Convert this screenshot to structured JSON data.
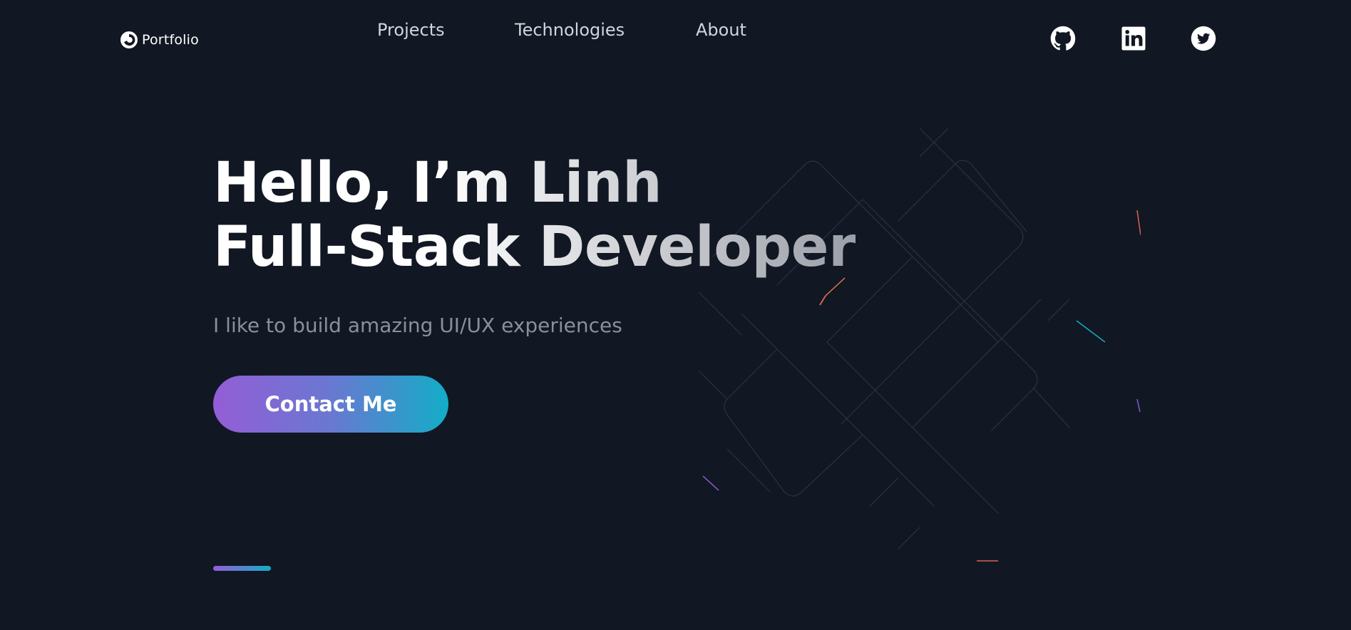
{
  "header": {
    "logo_text": "Portfolio",
    "nav": [
      {
        "label": "Projects"
      },
      {
        "label": "Technologies"
      },
      {
        "label": "About"
      }
    ],
    "social": [
      {
        "icon": "github-icon"
      },
      {
        "icon": "linkedin-icon"
      },
      {
        "icon": "twitter-icon"
      }
    ]
  },
  "hero": {
    "title_line1": "Hello, I’m Linh",
    "title_line2": "Full-Stack Developer",
    "subtitle": "I like to build amazing UI/UX experiences",
    "cta_label": "Contact Me"
  },
  "colors": {
    "background": "#111723",
    "gradient_start": "#945dd6",
    "gradient_mid": "#6978d1",
    "gradient_end": "#13adc7",
    "nav_text": "#d2d5dc",
    "subtitle_text": "#8b8f99"
  }
}
